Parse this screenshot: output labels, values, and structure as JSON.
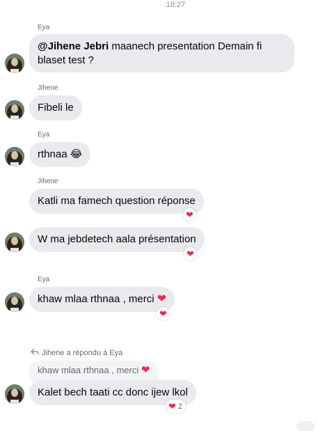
{
  "timestamp": "18:27",
  "messages": [
    {
      "sender": "Eya",
      "mention": "@Jihene Jebri",
      "text": " maanech presentation Demain fi blaset test ?"
    },
    {
      "sender": "Jihene",
      "text": "Fibeli le"
    },
    {
      "sender": "Eya",
      "text": "rthnaa",
      "emoji": "😂"
    },
    {
      "sender": "Jihene",
      "text": "Katli ma famech question réponse",
      "reaction": "❤"
    },
    {
      "text": "W ma jebdetech aala présentation",
      "reaction": "❤"
    },
    {
      "sender": "Eya",
      "text": "khaw mlaa rthnaa , merci",
      "emoji": "❤",
      "reaction": "❤"
    },
    {
      "reply_label": "Jihene a répondu à Eya",
      "quoted_text": "khaw mlaa rthnaa , merci",
      "quoted_emoji": "❤",
      "text": "Kalet bech taati cc donc ijew lkol",
      "reaction": "❤",
      "reaction_count": "2"
    }
  ],
  "colors": {
    "bubble": "#e9eaee",
    "heart": "#f02849",
    "meta_text": "#65676b"
  }
}
